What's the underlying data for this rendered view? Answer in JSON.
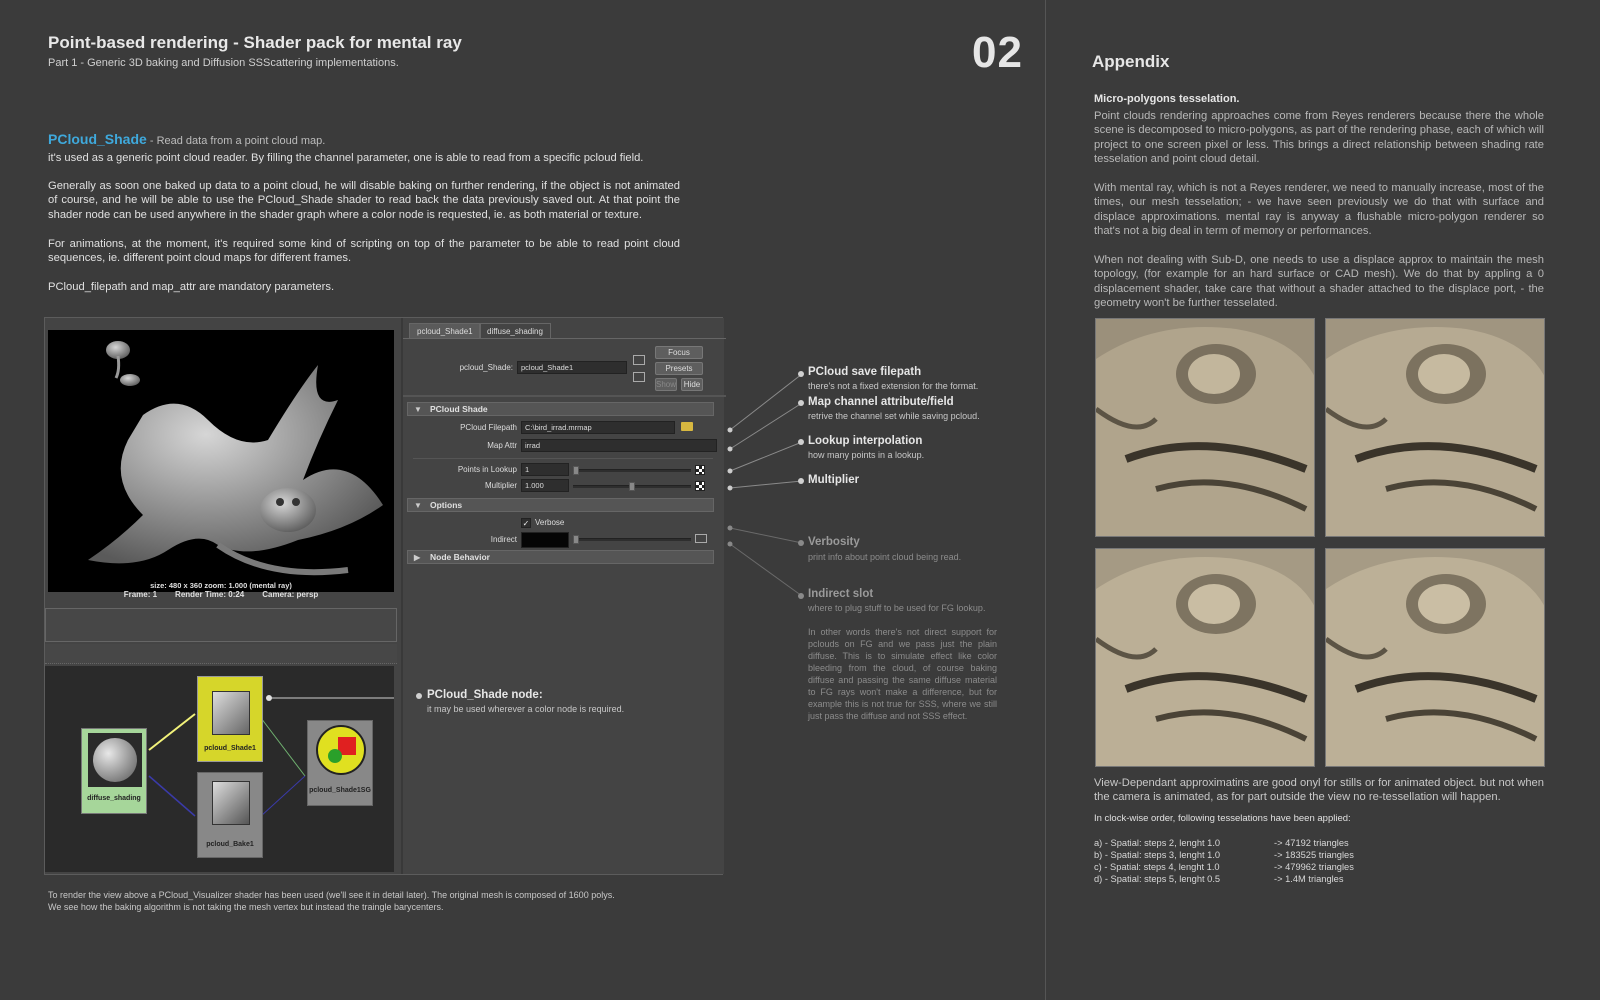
{
  "header": {
    "title": "Point-based  rendering - Shader pack for mental ray",
    "subtitle": "Part 1 - Generic 3D baking and Diffusion SSScattering implementations.",
    "page_number": "02"
  },
  "intro": {
    "shader_name": "PCloud_Shade",
    "shader_tagline": " -  Read data from a point cloud map.",
    "p1": "it's used as a generic  point cloud reader. By filling the channel parameter, one is able to read from a specific pcloud field.",
    "p2": "Generally as soon one baked up data to a point cloud, he will disable baking on further rendering, if the object is not animated of course, and he will be able to use the PCloud_Shade shader to read back the data previously saved out. At that point the shader node can be used anywhere in the shader graph where a color node is requested, ie. as both material or texture.",
    "p3": "For animations, at the moment, it's required some kind of scripting on top of the parameter to be able to read point cloud sequences, ie. different point cloud maps for different frames.",
    "p4": "PCloud_filepath and map_attr are mandatory parameters."
  },
  "render_view": {
    "info": "size: 480 x 360 zoom: 1.000        (mental ray)",
    "frame": "Frame: 1",
    "render_time": "Render Time: 0:24",
    "camera": "Camera: persp"
  },
  "hypershade": {
    "nodes": [
      "pcloud_Shade1",
      "diffuse_shading",
      "pcloud_Bake1",
      "pcloud_Shade1SG"
    ]
  },
  "attribute_editor": {
    "tabs": [
      "pcloud_Shade1",
      "diffuse_shading"
    ],
    "node_label": "pcloud_Shade:",
    "node_value": "pcloud_Shade1",
    "buttons": {
      "focus": "Focus",
      "presets": "Presets",
      "show": "Show",
      "hide": "Hide"
    },
    "section_pcloud": "PCloud Shade",
    "filepath_label": "PCloud Filepath",
    "filepath_value": "C:\\bird_irrad.mrmap",
    "mapattr_label": "Map Attr",
    "mapattr_value": "irrad",
    "lookup_label": "Points in Lookup",
    "lookup_value": "1",
    "multiplier_label": "Multiplier",
    "multiplier_value": "1.000",
    "section_options": "Options",
    "verbose_label": "Verbose",
    "indirect_label": "Indirect",
    "section_node": "Node Behavior"
  },
  "callouts": [
    {
      "title": "PCloud save filepath",
      "desc": "there's not a fixed extension for the format."
    },
    {
      "title": "Map channel attribute/field",
      "desc": "retrive the channel set while saving pcloud."
    },
    {
      "title": "Lookup interpolation",
      "desc": "how many points in a lookup."
    },
    {
      "title": "Multiplier",
      "desc": ""
    },
    {
      "title": "Verbosity",
      "desc": "print info about point cloud being read."
    },
    {
      "title": "Indirect slot",
      "desc": "where to plug stuff to be used for FG lookup."
    }
  ],
  "indirect_note": "In other words there's not direct support for pclouds on FG and we pass just the plain diffuse.  This is to simulate effect like color bleeding from the cloud,  of course baking diffuse and passing the same diffuse material to FG rays won't make a difference, but for example this is not true for SSS, where we still just pass the diffuse and not SSS effect.",
  "node_callout": {
    "title": "PCloud_Shade node:",
    "desc": "it may be used wherever a color node is required."
  },
  "footnote": {
    "line1": "To render  the view above a PCloud_Visualizer shader has been used (we'll see it in detail later). The original mesh is composed of 1600 polys.",
    "line2": "We see how the baking algorithm is not taking the mesh vertex but instead the traingle barycenters."
  },
  "appendix": {
    "title": "Appendix",
    "subtitle": "Micro-polygons tesselation.",
    "p1": "Point clouds rendering approaches come from Reyes renderers because there the whole scene is decomposed to micro-polygons, as part of the rendering phase, each of which will project to one screen pixel or less. This brings a direct relationship between shading rate tesselation and point cloud detail.",
    "p2": "With mental ray, which is not a Reyes renderer, we need to manually increase, most of the times, our mesh tesselation; - we have seen previously we do that with surface and displace approximations. mental ray is anyway a flushable micro-polygon renderer so that's not a big deal in term of memory or performances.",
    "p3": "When not dealing with Sub-D, one needs to use a displace approx to maintain the mesh topology, (for example for an hard surface or CAD mesh). We do that by appling a 0 displacement shader, take care that without a shader attached to the displace port, - the geometry won't be further tesselated.",
    "p4": "View-Dependant approximatins are good onyl for stills or for animated object. but not when the camera is animated, as for part outside the view no re-tessellation will happen.",
    "list_intro": "In clock-wise order, following tesselations have been applied:",
    "list": [
      {
        "spec": "a) - Spatial: steps 2, lenght 1.0",
        "result": "-> 47192 triangles"
      },
      {
        "spec": "b) - Spatial: steps 3, lenght 1.0",
        "result": "-> 183525 triangles"
      },
      {
        "spec": "c) - Spatial: steps 4, lenght 1.0",
        "result": "-> 479962 triangles"
      },
      {
        "spec": "d) - Spatial: steps 5, lenght 0.5",
        "result": "-> 1.4M triangles"
      }
    ]
  },
  "colors": {
    "background": "#3b3b3b",
    "accent": "#3fa9dc",
    "node_yellow": "#d6d62a",
    "node_green": "#a6d69a"
  }
}
